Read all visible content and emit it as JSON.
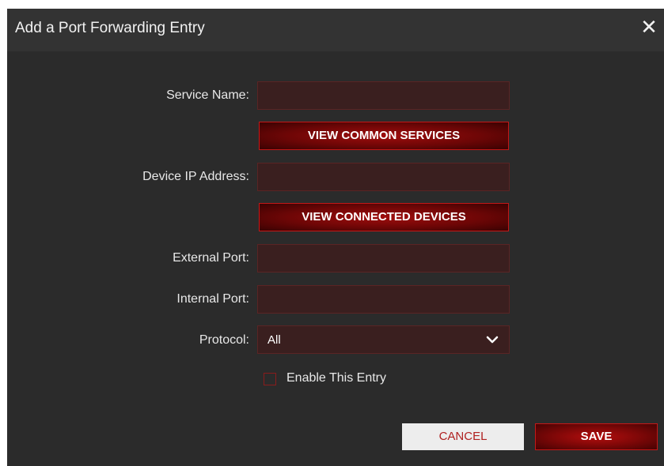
{
  "dialog": {
    "title": "Add a Port Forwarding Entry",
    "close_icon": "close-icon",
    "close_glyph": "✕"
  },
  "form": {
    "service_name": {
      "label": "Service Name:",
      "value": ""
    },
    "view_services_button": "VIEW COMMON SERVICES",
    "device_ip": {
      "label": "Device IP Address:",
      "value": ""
    },
    "view_devices_button": "VIEW CONNECTED DEVICES",
    "external_port": {
      "label": "External Port:",
      "value": ""
    },
    "internal_port": {
      "label": "Internal Port:",
      "value": ""
    },
    "protocol": {
      "label": "Protocol:",
      "selected": "All",
      "icon": "chevron-down-icon"
    },
    "enable_entry": {
      "label": "Enable This Entry",
      "checked": false
    }
  },
  "footer": {
    "cancel_label": "CANCEL",
    "save_label": "SAVE"
  },
  "colors": {
    "background": "#2b2b2b",
    "titlebar": "#333333",
    "field": "#3a1f1f",
    "accent": "#a00d0d",
    "cancel_bg": "#ededed",
    "cancel_text": "#b02020"
  }
}
